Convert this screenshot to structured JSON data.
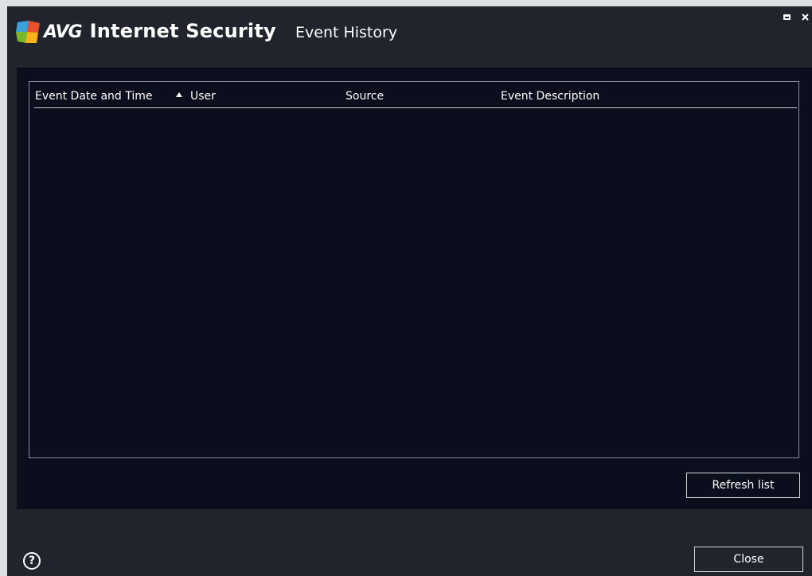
{
  "app": {
    "brand_avg": "AVG",
    "brand_product": "Internet Security",
    "window_title": "Event History"
  },
  "table": {
    "columns": [
      {
        "label": "Event Date and Time",
        "sorted": "ascending"
      },
      {
        "label": "User"
      },
      {
        "label": "Source"
      },
      {
        "label": "Event Description"
      }
    ],
    "rows": []
  },
  "buttons": {
    "refresh_label": "Refresh list",
    "close_label": "Close"
  },
  "help": {
    "glyph": "?"
  },
  "icons": {
    "logo": "avg-logo-icon",
    "sort": "sort-ascending-icon",
    "restore": "restore-window-icon",
    "close": "close-window-icon",
    "help": "help-icon"
  },
  "colors": {
    "window_bg": "#21242c",
    "content_bg": "#0b0e1c",
    "text": "#ffffff",
    "border": "#d8d9de"
  }
}
